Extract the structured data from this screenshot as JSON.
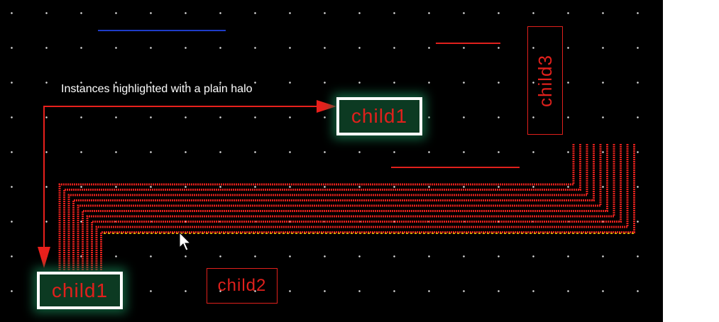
{
  "annotation": {
    "text": "Instances highlighted with a plain halo"
  },
  "instances": {
    "child1_top": "child1",
    "child1_bottom": "child1",
    "child2": "child2",
    "child3": "child3"
  },
  "colors": {
    "background": "#000000",
    "grid_dot": "#d8d8d8",
    "wire": "#e0201c",
    "halo_border": "#ffffff",
    "halo_fill": "#0c3a22",
    "selection_dash": "#ffd800",
    "blue_wire": "#1e3cc8"
  },
  "icons": {
    "cursor": "arrow-pointer-icon"
  }
}
